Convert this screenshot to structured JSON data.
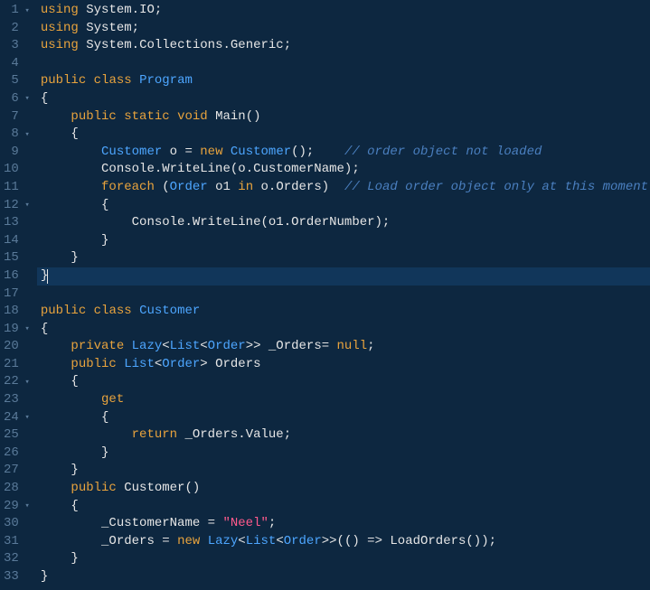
{
  "lines": [
    {
      "num": 1,
      "fold": "▾",
      "tokens": [
        [
          "kw",
          "using"
        ],
        [
          "txt",
          " "
        ],
        [
          "cls",
          "System"
        ],
        [
          "punct",
          "."
        ],
        [
          "cls",
          "IO"
        ],
        [
          "punct",
          ";"
        ]
      ]
    },
    {
      "num": 2,
      "fold": "",
      "tokens": [
        [
          "kw",
          "using"
        ],
        [
          "txt",
          " "
        ],
        [
          "cls",
          "System"
        ],
        [
          "punct",
          ";"
        ]
      ]
    },
    {
      "num": 3,
      "fold": "",
      "tokens": [
        [
          "kw",
          "using"
        ],
        [
          "txt",
          " "
        ],
        [
          "cls",
          "System"
        ],
        [
          "punct",
          "."
        ],
        [
          "cls",
          "Collections"
        ],
        [
          "punct",
          "."
        ],
        [
          "cls",
          "Generic"
        ],
        [
          "punct",
          ";"
        ]
      ]
    },
    {
      "num": 4,
      "fold": "",
      "tokens": []
    },
    {
      "num": 5,
      "fold": "",
      "tokens": [
        [
          "kw",
          "public"
        ],
        [
          "txt",
          " "
        ],
        [
          "kw",
          "class"
        ],
        [
          "txt",
          " "
        ],
        [
          "type",
          "Program"
        ]
      ]
    },
    {
      "num": 6,
      "fold": "▾",
      "tokens": [
        [
          "punct",
          "{"
        ]
      ]
    },
    {
      "num": 7,
      "fold": "",
      "tokens": [
        [
          "txt",
          "    "
        ],
        [
          "kw",
          "public"
        ],
        [
          "txt",
          " "
        ],
        [
          "kw",
          "static"
        ],
        [
          "txt",
          " "
        ],
        [
          "kw",
          "void"
        ],
        [
          "txt",
          " "
        ],
        [
          "mtd",
          "Main"
        ],
        [
          "punct",
          "()"
        ]
      ]
    },
    {
      "num": 8,
      "fold": "▾",
      "tokens": [
        [
          "txt",
          "    "
        ],
        [
          "punct",
          "{"
        ]
      ]
    },
    {
      "num": 9,
      "fold": "",
      "tokens": [
        [
          "txt",
          "        "
        ],
        [
          "type",
          "Customer"
        ],
        [
          "txt",
          " "
        ],
        [
          "id",
          "o"
        ],
        [
          "txt",
          " "
        ],
        [
          "punct",
          "="
        ],
        [
          "txt",
          " "
        ],
        [
          "kw",
          "new"
        ],
        [
          "txt",
          " "
        ],
        [
          "type",
          "Customer"
        ],
        [
          "punct",
          "();"
        ],
        [
          "txt",
          "    "
        ],
        [
          "cmt",
          "// order object not loaded"
        ]
      ]
    },
    {
      "num": 10,
      "fold": "",
      "tokens": [
        [
          "txt",
          "        "
        ],
        [
          "cls",
          "Console"
        ],
        [
          "punct",
          "."
        ],
        [
          "mtd",
          "WriteLine"
        ],
        [
          "punct",
          "("
        ],
        [
          "id",
          "o"
        ],
        [
          "punct",
          "."
        ],
        [
          "id",
          "CustomerName"
        ],
        [
          "punct",
          ");"
        ]
      ]
    },
    {
      "num": 11,
      "fold": "",
      "tokens": [
        [
          "txt",
          "        "
        ],
        [
          "kw",
          "foreach"
        ],
        [
          "txt",
          " "
        ],
        [
          "punct",
          "("
        ],
        [
          "type",
          "Order"
        ],
        [
          "txt",
          " "
        ],
        [
          "id",
          "o1"
        ],
        [
          "txt",
          " "
        ],
        [
          "kw",
          "in"
        ],
        [
          "txt",
          " "
        ],
        [
          "id",
          "o"
        ],
        [
          "punct",
          "."
        ],
        [
          "id",
          "Orders"
        ],
        [
          "punct",
          ")"
        ],
        [
          "txt",
          "  "
        ],
        [
          "cmt",
          "// Load order object only at this moment"
        ]
      ]
    },
    {
      "num": 12,
      "fold": "▾",
      "tokens": [
        [
          "txt",
          "        "
        ],
        [
          "punct",
          "{"
        ]
      ]
    },
    {
      "num": 13,
      "fold": "",
      "tokens": [
        [
          "txt",
          "            "
        ],
        [
          "cls",
          "Console"
        ],
        [
          "punct",
          "."
        ],
        [
          "mtd",
          "WriteLine"
        ],
        [
          "punct",
          "("
        ],
        [
          "id",
          "o1"
        ],
        [
          "punct",
          "."
        ],
        [
          "id",
          "OrderNumber"
        ],
        [
          "punct",
          ");"
        ]
      ]
    },
    {
      "num": 14,
      "fold": "",
      "tokens": [
        [
          "txt",
          "        "
        ],
        [
          "punct",
          "}"
        ]
      ]
    },
    {
      "num": 15,
      "fold": "",
      "tokens": [
        [
          "txt",
          "    "
        ],
        [
          "punct",
          "}"
        ]
      ]
    },
    {
      "num": 16,
      "fold": "",
      "highlighted": true,
      "cursor": true,
      "tokens": [
        [
          "punct",
          "}"
        ]
      ]
    },
    {
      "num": 17,
      "fold": "",
      "tokens": []
    },
    {
      "num": 18,
      "fold": "",
      "tokens": [
        [
          "kw",
          "public"
        ],
        [
          "txt",
          " "
        ],
        [
          "kw",
          "class"
        ],
        [
          "txt",
          " "
        ],
        [
          "type",
          "Customer"
        ]
      ]
    },
    {
      "num": 19,
      "fold": "▾",
      "tokens": [
        [
          "punct",
          "{"
        ]
      ]
    },
    {
      "num": 20,
      "fold": "",
      "tokens": [
        [
          "txt",
          "    "
        ],
        [
          "kw",
          "private"
        ],
        [
          "txt",
          " "
        ],
        [
          "type",
          "Lazy"
        ],
        [
          "punct",
          "<"
        ],
        [
          "type",
          "List"
        ],
        [
          "punct",
          "<"
        ],
        [
          "type",
          "Order"
        ],
        [
          "punct",
          ">>"
        ],
        [
          "txt",
          " "
        ],
        [
          "id",
          "_Orders"
        ],
        [
          "punct",
          "="
        ],
        [
          "txt",
          " "
        ],
        [
          "null",
          "null"
        ],
        [
          "punct",
          ";"
        ]
      ]
    },
    {
      "num": 21,
      "fold": "",
      "tokens": [
        [
          "txt",
          "    "
        ],
        [
          "kw",
          "public"
        ],
        [
          "txt",
          " "
        ],
        [
          "type",
          "List"
        ],
        [
          "punct",
          "<"
        ],
        [
          "type",
          "Order"
        ],
        [
          "punct",
          ">"
        ],
        [
          "txt",
          " "
        ],
        [
          "id",
          "Orders"
        ]
      ]
    },
    {
      "num": 22,
      "fold": "▾",
      "tokens": [
        [
          "txt",
          "    "
        ],
        [
          "punct",
          "{"
        ]
      ]
    },
    {
      "num": 23,
      "fold": "",
      "tokens": [
        [
          "txt",
          "        "
        ],
        [
          "kw",
          "get"
        ]
      ]
    },
    {
      "num": 24,
      "fold": "▾",
      "tokens": [
        [
          "txt",
          "        "
        ],
        [
          "punct",
          "{"
        ]
      ]
    },
    {
      "num": 25,
      "fold": "",
      "tokens": [
        [
          "txt",
          "            "
        ],
        [
          "kw",
          "return"
        ],
        [
          "txt",
          " "
        ],
        [
          "id",
          "_Orders"
        ],
        [
          "punct",
          "."
        ],
        [
          "id",
          "Value"
        ],
        [
          "punct",
          ";"
        ]
      ]
    },
    {
      "num": 26,
      "fold": "",
      "tokens": [
        [
          "txt",
          "        "
        ],
        [
          "punct",
          "}"
        ]
      ]
    },
    {
      "num": 27,
      "fold": "",
      "tokens": [
        [
          "txt",
          "    "
        ],
        [
          "punct",
          "}"
        ]
      ]
    },
    {
      "num": 28,
      "fold": "",
      "tokens": [
        [
          "txt",
          "    "
        ],
        [
          "kw",
          "public"
        ],
        [
          "txt",
          " "
        ],
        [
          "mtd",
          "Customer"
        ],
        [
          "punct",
          "()"
        ]
      ]
    },
    {
      "num": 29,
      "fold": "▾",
      "tokens": [
        [
          "txt",
          "    "
        ],
        [
          "punct",
          "{"
        ]
      ]
    },
    {
      "num": 30,
      "fold": "",
      "tokens": [
        [
          "txt",
          "        "
        ],
        [
          "id",
          "_CustomerName"
        ],
        [
          "txt",
          " "
        ],
        [
          "punct",
          "="
        ],
        [
          "txt",
          " "
        ],
        [
          "str",
          "\"Neel\""
        ],
        [
          "punct",
          ";"
        ]
      ]
    },
    {
      "num": 31,
      "fold": "",
      "tokens": [
        [
          "txt",
          "        "
        ],
        [
          "id",
          "_Orders"
        ],
        [
          "txt",
          " "
        ],
        [
          "punct",
          "="
        ],
        [
          "txt",
          " "
        ],
        [
          "kw",
          "new"
        ],
        [
          "txt",
          " "
        ],
        [
          "type",
          "Lazy"
        ],
        [
          "punct",
          "<"
        ],
        [
          "type",
          "List"
        ],
        [
          "punct",
          "<"
        ],
        [
          "type",
          "Order"
        ],
        [
          "punct",
          ">>"
        ],
        [
          "punct",
          "(()"
        ],
        [
          "txt",
          " "
        ],
        [
          "punct",
          "=>"
        ],
        [
          "txt",
          " "
        ],
        [
          "mtd",
          "LoadOrders"
        ],
        [
          "punct",
          "());"
        ]
      ]
    },
    {
      "num": 32,
      "fold": "",
      "tokens": [
        [
          "txt",
          "    "
        ],
        [
          "punct",
          "}"
        ]
      ]
    },
    {
      "num": 33,
      "fold": "",
      "tokens": [
        [
          "punct",
          "}"
        ]
      ]
    }
  ]
}
